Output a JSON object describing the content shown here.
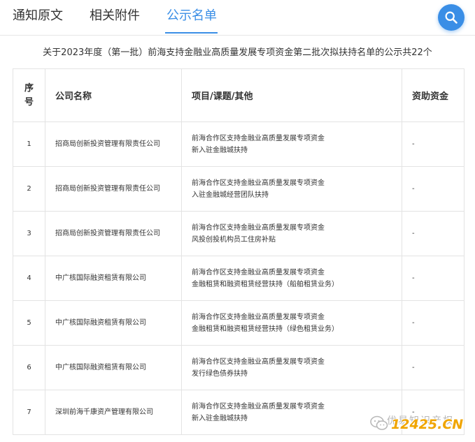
{
  "tabs": [
    {
      "label": "通知原文",
      "active": false
    },
    {
      "label": "相关附件",
      "active": false
    },
    {
      "label": "公示名单",
      "active": true
    }
  ],
  "search": {
    "icon": "search-icon"
  },
  "notice_title": "关于2023年度（第一批）前海支持金融业高质量发展专项资金第二批次拟扶持名单的公示共22个",
  "table": {
    "headers": {
      "seq": "序号",
      "company": "公司名称",
      "project": "项目/课题/其他",
      "funding": "资助资金"
    },
    "rows": [
      {
        "seq": "1",
        "company": "招商局创新投资管理有限责任公司",
        "project_line1": "前海合作区支持金融业高质量发展专项资金",
        "project_line2": "新入驻金融城扶持",
        "funding": "-"
      },
      {
        "seq": "2",
        "company": "招商局创新投资管理有限责任公司",
        "project_line1": "前海合作区支持金融业高质量发展专项资金",
        "project_line2": "入驻金融城经营团队扶持",
        "funding": "-"
      },
      {
        "seq": "3",
        "company": "招商局创新投资管理有限责任公司",
        "project_line1": "前海合作区支持金融业高质量发展专项资金",
        "project_line2": "风投创投机构员工住房补贴",
        "funding": "-"
      },
      {
        "seq": "4",
        "company": "中广核国际融资租赁有限公司",
        "project_line1": "前海合作区支持金融业高质量发展专项资金",
        "project_line2": "金融租赁和融资租赁经营扶持（船舶租赁业务）",
        "funding": "-"
      },
      {
        "seq": "5",
        "company": "中广核国际融资租赁有限公司",
        "project_line1": "前海合作区支持金融业高质量发展专项资金",
        "project_line2": "金融租赁和融资租赁经营扶持（绿色租赁业务）",
        "funding": "-"
      },
      {
        "seq": "6",
        "company": "中广核国际融资租赁有限公司",
        "project_line1": "前海合作区支持金融业高质量发展专项资金",
        "project_line2": "发行绿色债券扶持",
        "funding": "-"
      },
      {
        "seq": "7",
        "company": "深圳前海千康资产管理有限公司",
        "project_line1": "前海合作区支持金融业高质量发展专项资金",
        "project_line2": "新入驻金融城扶持",
        "funding": "-"
      }
    ]
  },
  "watermark": {
    "text": "优易知识产权",
    "domain": "12425.CN",
    "icon": "wechat-icon",
    "color": "#f0a500"
  },
  "colors": {
    "accent": "#3a8ee6",
    "text": "#333333",
    "border": "#e3e3e3"
  }
}
